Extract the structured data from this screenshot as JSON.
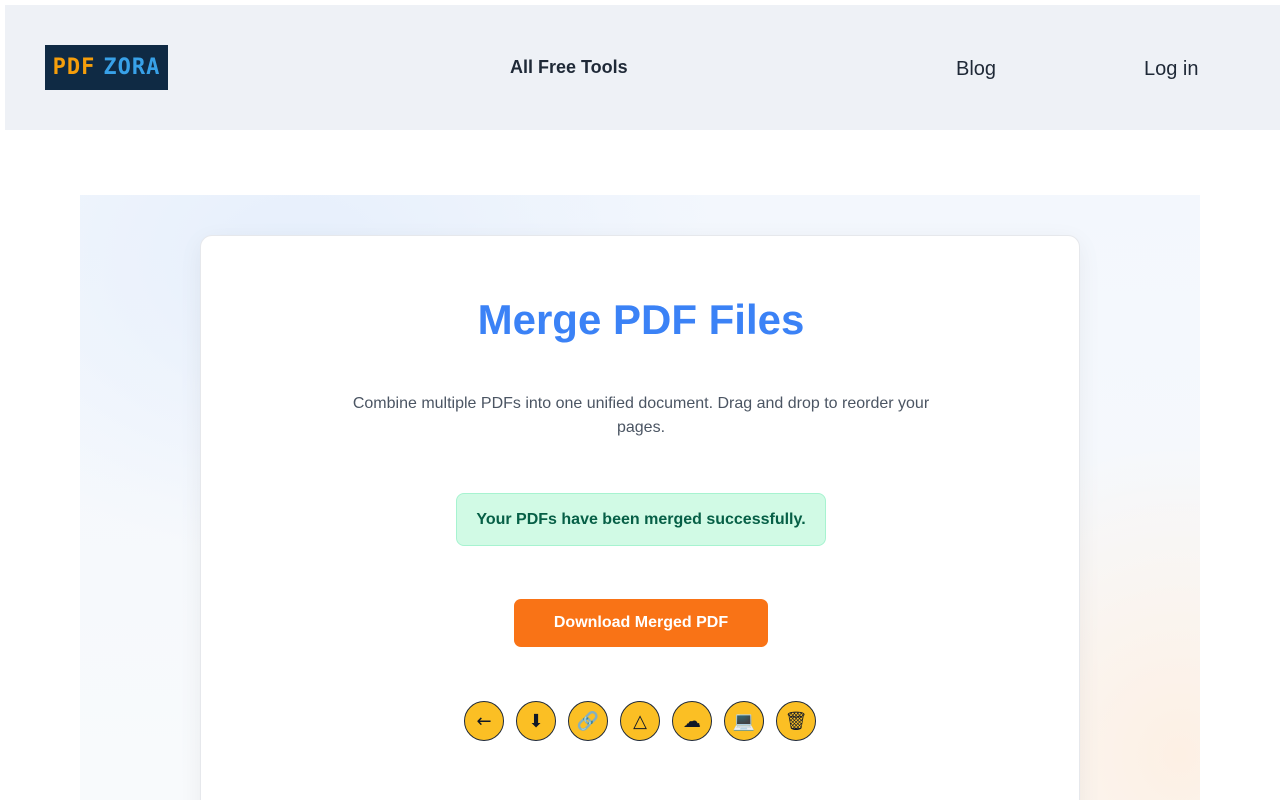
{
  "header": {
    "logo": {
      "part1": "PDF",
      "part2": "ZORA"
    },
    "nav": {
      "all_tools": "All Free Tools",
      "blog": "Blog",
      "login": "Log in"
    }
  },
  "main": {
    "title": "Merge PDF Files",
    "subtitle": "Combine multiple PDFs into one unified document. Drag and drop to reorder your pages.",
    "success_message": "Your PDFs have been merged successfully.",
    "download_label": "Download Merged PDF",
    "actions": [
      {
        "name": "back-arrow-icon",
        "glyph": "←"
      },
      {
        "name": "download-icon",
        "glyph": "⬇"
      },
      {
        "name": "link-icon",
        "glyph": "🔗"
      },
      {
        "name": "drive-icon",
        "glyph": "△"
      },
      {
        "name": "cloud-icon",
        "glyph": "☁"
      },
      {
        "name": "computer-icon",
        "glyph": "💻"
      },
      {
        "name": "trash-icon",
        "glyph": "🗑"
      }
    ]
  },
  "colors": {
    "accent_blue": "#3b82f6",
    "button_orange": "#f97316",
    "icon_yellow": "#fbbf24",
    "success_bg": "#d1fae5",
    "success_text": "#065f46"
  }
}
